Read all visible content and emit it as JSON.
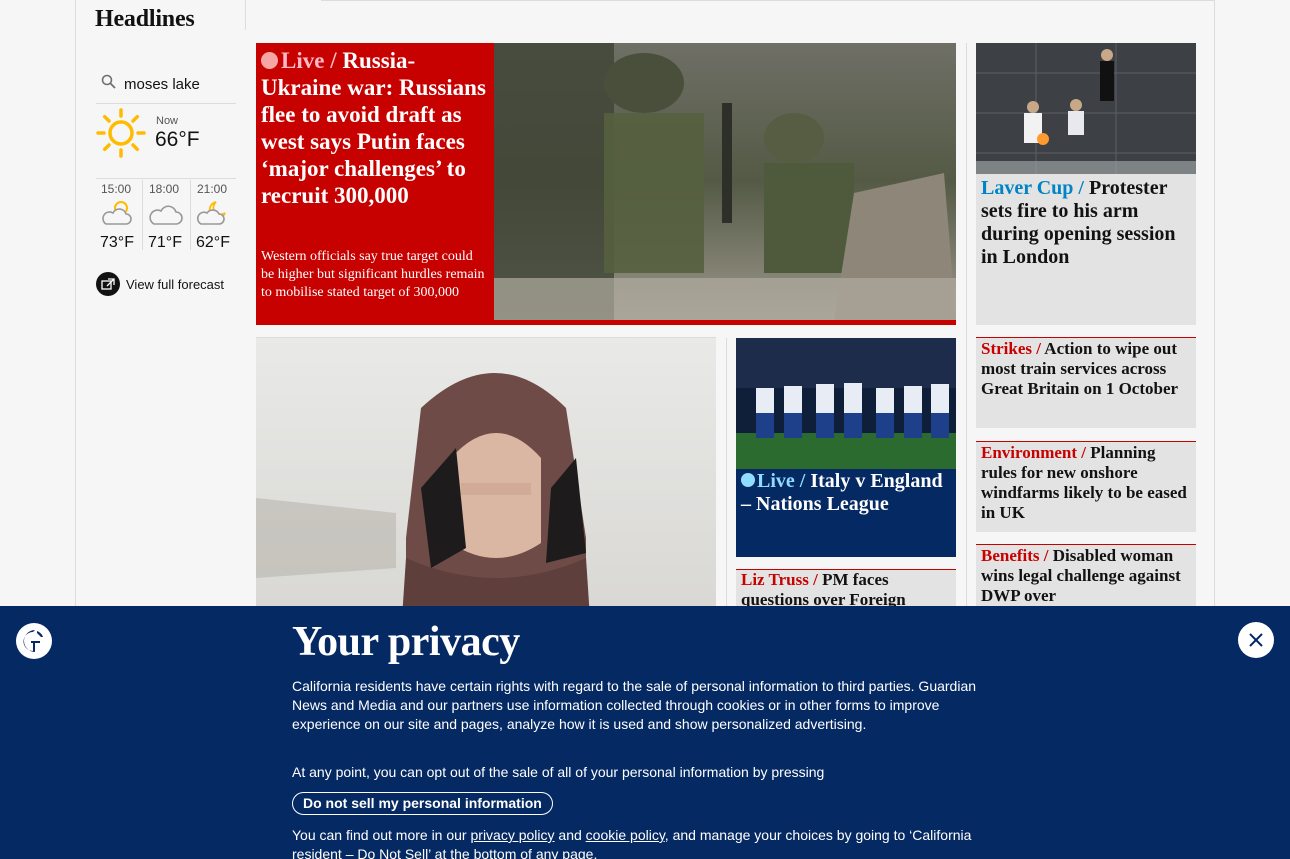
{
  "section": {
    "title": "Headlines"
  },
  "weather": {
    "location": "moses lake",
    "now_label": "Now",
    "now_temp": "66°F",
    "forecast": [
      {
        "time": "15:00",
        "temp": "73°F",
        "icon": "partly-cloudy-sun-icon"
      },
      {
        "time": "18:00",
        "temp": "71°F",
        "icon": "cloud-icon"
      },
      {
        "time": "21:00",
        "temp": "62°F",
        "icon": "cloudy-moon-icon"
      }
    ],
    "view_forecast": "View full forecast"
  },
  "feature": {
    "kicker": "Live",
    "headline": "Russia-Ukraine war: Russians flee to avoid draft as west says Putin faces ‘major challenges’ to recruit 300,000",
    "standfirst": "Western officials say true target could be higher but significant hurdles remain to mobilise stated target of 300,000"
  },
  "laver": {
    "kicker": "Laver Cup",
    "headline": "Protester sets fire to his arm during opening session in London"
  },
  "italy": {
    "kicker": "Live",
    "headline": "Italy v England – Nations League"
  },
  "truss": {
    "kicker": "Liz Truss",
    "headline": "PM faces questions over Foreign"
  },
  "cards": [
    {
      "kicker": "Strikes",
      "headline": "Action to wipe out most train services across Great Britain on 1 October"
    },
    {
      "kicker": "Environment",
      "headline": "Planning rules for new onshore windfarms likely to be eased in UK"
    },
    {
      "kicker": "Benefits",
      "headline": "Disabled woman wins legal challenge against DWP over"
    }
  ],
  "privacy": {
    "title": "Your privacy",
    "p1": "California residents have certain rights with regard to the sale of personal information to third parties. Guardian News and Media and our partners use information collected through cookies or in other forms to improve experience on our site and pages, analyze how it is used and show personalized advertising.",
    "p2": "At any point, you can opt out of the sale of all of your personal information by pressing",
    "button": "Do not sell my personal information",
    "p3_a": "You can find out more in our ",
    "privacy_link": "privacy policy",
    "p3_b": " and ",
    "cookie_link": "cookie policy",
    "p3_c": ", and manage your choices by going to ‘California resident – Do Not Sell’ at the bottom of any page."
  },
  "colors": {
    "news_red": "#c70000",
    "brand_blue": "#052962",
    "sport_blue": "#0084c6"
  }
}
